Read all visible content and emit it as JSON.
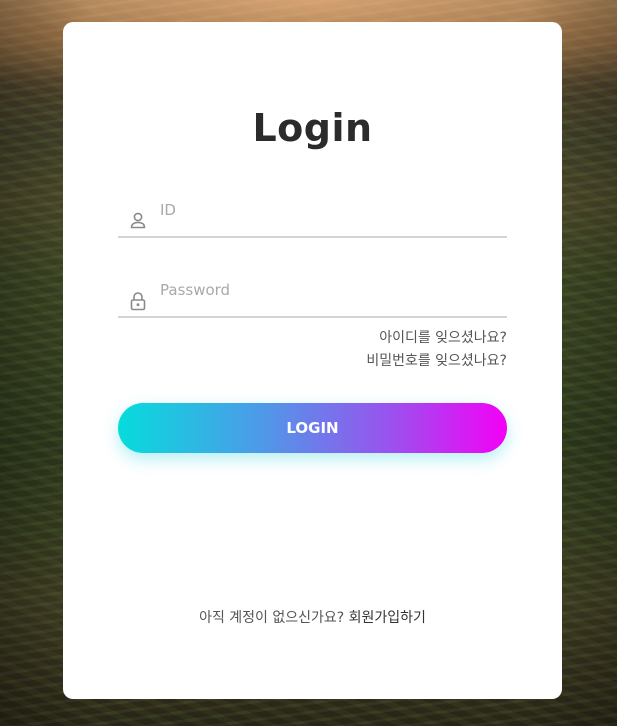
{
  "login": {
    "title": "Login",
    "id_field": {
      "placeholder": "ID",
      "value": "",
      "icon": "user-icon"
    },
    "password_field": {
      "placeholder": "Password",
      "value": "",
      "icon": "lock-icon"
    },
    "forgot_id": "아이디를 잊으셨나요?",
    "forgot_password": "비밀번호를 잊으셨나요?",
    "login_button": "LOGIN",
    "signup_prompt": "아직 계정이 없으신가요?",
    "signup_link": "회원가입하기"
  },
  "colors": {
    "gradient_start": "#06dcdc",
    "gradient_end": "#f400f6",
    "title": "#2b2b2b",
    "placeholder": "#a9a9a9",
    "underline": "#d4d4d4"
  }
}
